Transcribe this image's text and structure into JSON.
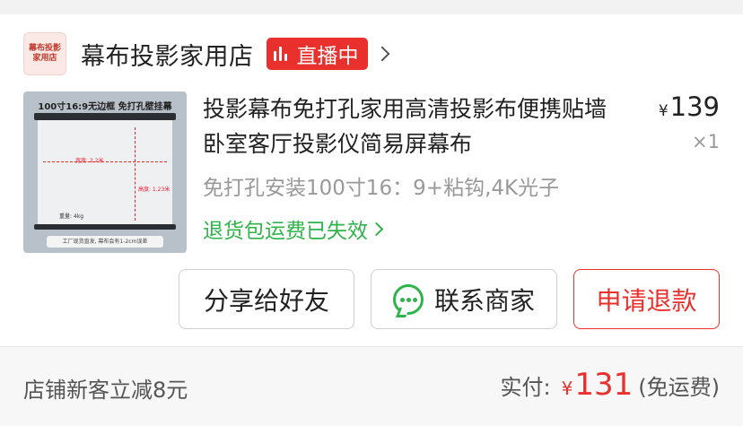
{
  "shop": {
    "logo_line1": "幕布投影",
    "logo_line2": "家用店",
    "name": "幕布投影家用店",
    "live_label": "直播中"
  },
  "product": {
    "thumb_title": "100寸16:9无边框 免打孔壁挂幕",
    "thumb_width": "宽度: 2.2米",
    "thumb_height": "高度: 1.23米",
    "thumb_weight": "重量: 4kg",
    "thumb_footer": "工厂现货直发, 幕布会有1-2cm误差",
    "title": "投影幕布免打孔家用高清投影布便携贴墙卧室客厅投影仪简易屏幕布",
    "spec": "免打孔安装100寸16：9+粘钩,4K光子",
    "refund_note": "退货包运费已失效",
    "price_symbol": "¥",
    "price": "139",
    "quantity": "×1"
  },
  "actions": {
    "share": "分享给好友",
    "contact": "联系商家",
    "refund": "申请退款"
  },
  "footer": {
    "promo": "店铺新客立减8元",
    "paid_label": "实付:",
    "paid_symbol": "¥",
    "paid_amount": "131",
    "shipping": "(免运费)"
  },
  "colors": {
    "accent_red": "#e9302d",
    "green": "#2fb34a"
  }
}
